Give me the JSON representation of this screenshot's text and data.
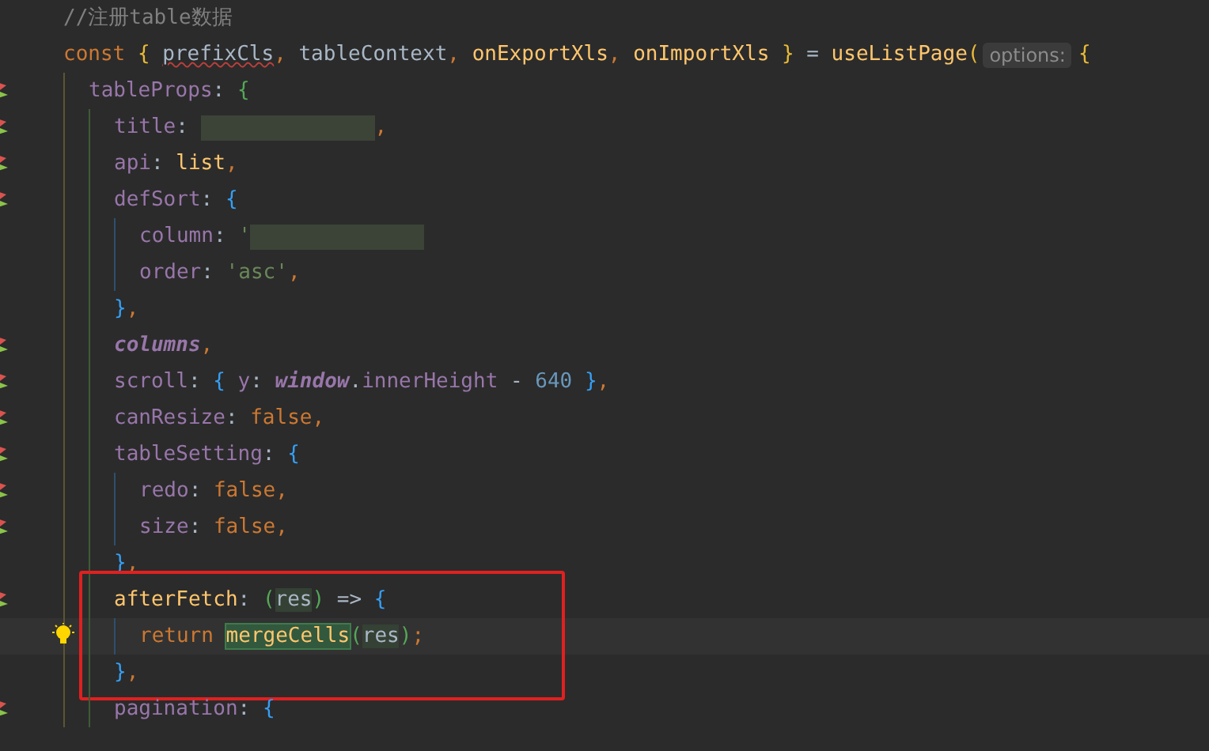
{
  "editor": {
    "lines": [
      {
        "tokens": [
          {
            "kind": "comment",
            "text": "//注册table数据"
          }
        ]
      },
      {
        "tokens": [
          {
            "kind": "keyword",
            "text": "const "
          },
          {
            "kind": "bracket-a",
            "text": "{ "
          },
          {
            "kind": "ident",
            "text": "prefixCls",
            "squiggle": true
          },
          {
            "kind": "punct",
            "text": ", "
          },
          {
            "kind": "ident",
            "text": "tableContext"
          },
          {
            "kind": "punct",
            "text": ", "
          },
          {
            "kind": "func",
            "text": "onExportXls"
          },
          {
            "kind": "punct",
            "text": ", "
          },
          {
            "kind": "func",
            "text": "onImportXls "
          },
          {
            "kind": "bracket-a",
            "text": "}"
          },
          {
            "kind": "op",
            "text": " = "
          },
          {
            "kind": "func",
            "text": "useListPage"
          },
          {
            "kind": "bracket-a",
            "text": "("
          },
          {
            "kind": "hint",
            "text": "options:"
          },
          {
            "kind": "bracket-a",
            "text": "{"
          }
        ],
        "children": [
          {
            "marker": true,
            "tokens": [
              {
                "kind": "prop",
                "text": "tableProps"
              },
              {
                "kind": "op",
                "text": ": "
              },
              {
                "kind": "bracket-b",
                "text": "{"
              }
            ],
            "children": [
              {
                "marker": true,
                "tokens": [
                  {
                    "kind": "prop",
                    "text": "title"
                  },
                  {
                    "kind": "op",
                    "text": ": "
                  },
                  {
                    "kind": "redacted"
                  },
                  {
                    "kind": "punct",
                    "text": ","
                  }
                ]
              },
              {
                "marker": true,
                "tokens": [
                  {
                    "kind": "prop",
                    "text": "api"
                  },
                  {
                    "kind": "op",
                    "text": ": "
                  },
                  {
                    "kind": "func",
                    "text": "list"
                  },
                  {
                    "kind": "punct",
                    "text": ","
                  }
                ]
              },
              {
                "marker": true,
                "tokens": [
                  {
                    "kind": "prop",
                    "text": "defSort"
                  },
                  {
                    "kind": "op",
                    "text": ": "
                  },
                  {
                    "kind": "bracket-c",
                    "text": "{"
                  }
                ],
                "children": [
                  {
                    "tokens": [
                      {
                        "kind": "prop",
                        "text": "column"
                      },
                      {
                        "kind": "op",
                        "text": ": "
                      },
                      {
                        "kind": "string",
                        "text": "'"
                      },
                      {
                        "kind": "redacted"
                      }
                    ]
                  },
                  {
                    "tokens": [
                      {
                        "kind": "prop",
                        "text": "order"
                      },
                      {
                        "kind": "op",
                        "text": ": "
                      },
                      {
                        "kind": "string",
                        "text": "'asc'"
                      },
                      {
                        "kind": "punct",
                        "text": ","
                      }
                    ]
                  }
                ]
              },
              {
                "tokens": [
                  {
                    "kind": "bracket-c",
                    "text": "}"
                  },
                  {
                    "kind": "punct",
                    "text": ","
                  }
                ]
              },
              {
                "marker": true,
                "tokens": [
                  {
                    "kind": "global",
                    "text": "columns"
                  },
                  {
                    "kind": "punct",
                    "text": ","
                  }
                ]
              },
              {
                "marker": true,
                "tokens": [
                  {
                    "kind": "prop",
                    "text": "scroll"
                  },
                  {
                    "kind": "op",
                    "text": ": "
                  },
                  {
                    "kind": "bracket-c",
                    "text": "{ "
                  },
                  {
                    "kind": "prop",
                    "text": "y"
                  },
                  {
                    "kind": "op",
                    "text": ": "
                  },
                  {
                    "kind": "global",
                    "text": "window"
                  },
                  {
                    "kind": "op",
                    "text": "."
                  },
                  {
                    "kind": "prop",
                    "text": "innerHeight"
                  },
                  {
                    "kind": "op",
                    "text": " - "
                  },
                  {
                    "kind": "number",
                    "text": "640 "
                  },
                  {
                    "kind": "bracket-c",
                    "text": "}"
                  },
                  {
                    "kind": "punct",
                    "text": ","
                  }
                ]
              },
              {
                "marker": true,
                "tokens": [
                  {
                    "kind": "prop",
                    "text": "canResize"
                  },
                  {
                    "kind": "op",
                    "text": ": "
                  },
                  {
                    "kind": "keyword",
                    "text": "false"
                  },
                  {
                    "kind": "punct",
                    "text": ","
                  }
                ]
              },
              {
                "marker": true,
                "tokens": [
                  {
                    "kind": "prop",
                    "text": "tableSetting"
                  },
                  {
                    "kind": "op",
                    "text": ": "
                  },
                  {
                    "kind": "bracket-c",
                    "text": "{"
                  }
                ],
                "children": [
                  {
                    "marker": true,
                    "tokens": [
                      {
                        "kind": "prop",
                        "text": "redo"
                      },
                      {
                        "kind": "op",
                        "text": ": "
                      },
                      {
                        "kind": "keyword",
                        "text": "false"
                      },
                      {
                        "kind": "punct",
                        "text": ","
                      }
                    ]
                  },
                  {
                    "marker": true,
                    "tokens": [
                      {
                        "kind": "prop",
                        "text": "size"
                      },
                      {
                        "kind": "op",
                        "text": ": "
                      },
                      {
                        "kind": "keyword",
                        "text": "false"
                      },
                      {
                        "kind": "punct",
                        "text": ","
                      }
                    ]
                  }
                ]
              },
              {
                "tokens": [
                  {
                    "kind": "bracket-c",
                    "text": "}"
                  },
                  {
                    "kind": "punct",
                    "text": ","
                  }
                ]
              },
              {
                "marker": true,
                "boxed": true,
                "tokens": [
                  {
                    "kind": "func",
                    "text": "afterFetch"
                  },
                  {
                    "kind": "op",
                    "text": ": "
                  },
                  {
                    "kind": "bracket-b",
                    "text": "("
                  },
                  {
                    "kind": "ident",
                    "text": "res",
                    "usage": true
                  },
                  {
                    "kind": "bracket-b",
                    "text": ")"
                  },
                  {
                    "kind": "op",
                    "text": " => "
                  },
                  {
                    "kind": "bracket-c",
                    "text": "{"
                  }
                ],
                "children": [
                  {
                    "current": true,
                    "bulb": true,
                    "boxed": true,
                    "tokens": [
                      {
                        "kind": "keyword",
                        "text": "return "
                      },
                      {
                        "kind": "func",
                        "text": "mergeCells",
                        "match": true
                      },
                      {
                        "kind": "bracket-b",
                        "text": "("
                      },
                      {
                        "kind": "ident",
                        "text": "res",
                        "usage": true
                      },
                      {
                        "kind": "bracket-b",
                        "text": ")"
                      },
                      {
                        "kind": "punct",
                        "text": ";"
                      }
                    ]
                  }
                ]
              },
              {
                "boxed": true,
                "tokens": [
                  {
                    "kind": "bracket-c",
                    "text": "}"
                  },
                  {
                    "kind": "punct",
                    "text": ","
                  }
                ]
              },
              {
                "marker": true,
                "tokens": [
                  {
                    "kind": "prop",
                    "text": "pagination"
                  },
                  {
                    "kind": "op",
                    "text": ": "
                  },
                  {
                    "kind": "bracket-c",
                    "text": "{"
                  }
                ]
              }
            ]
          }
        ]
      }
    ]
  }
}
